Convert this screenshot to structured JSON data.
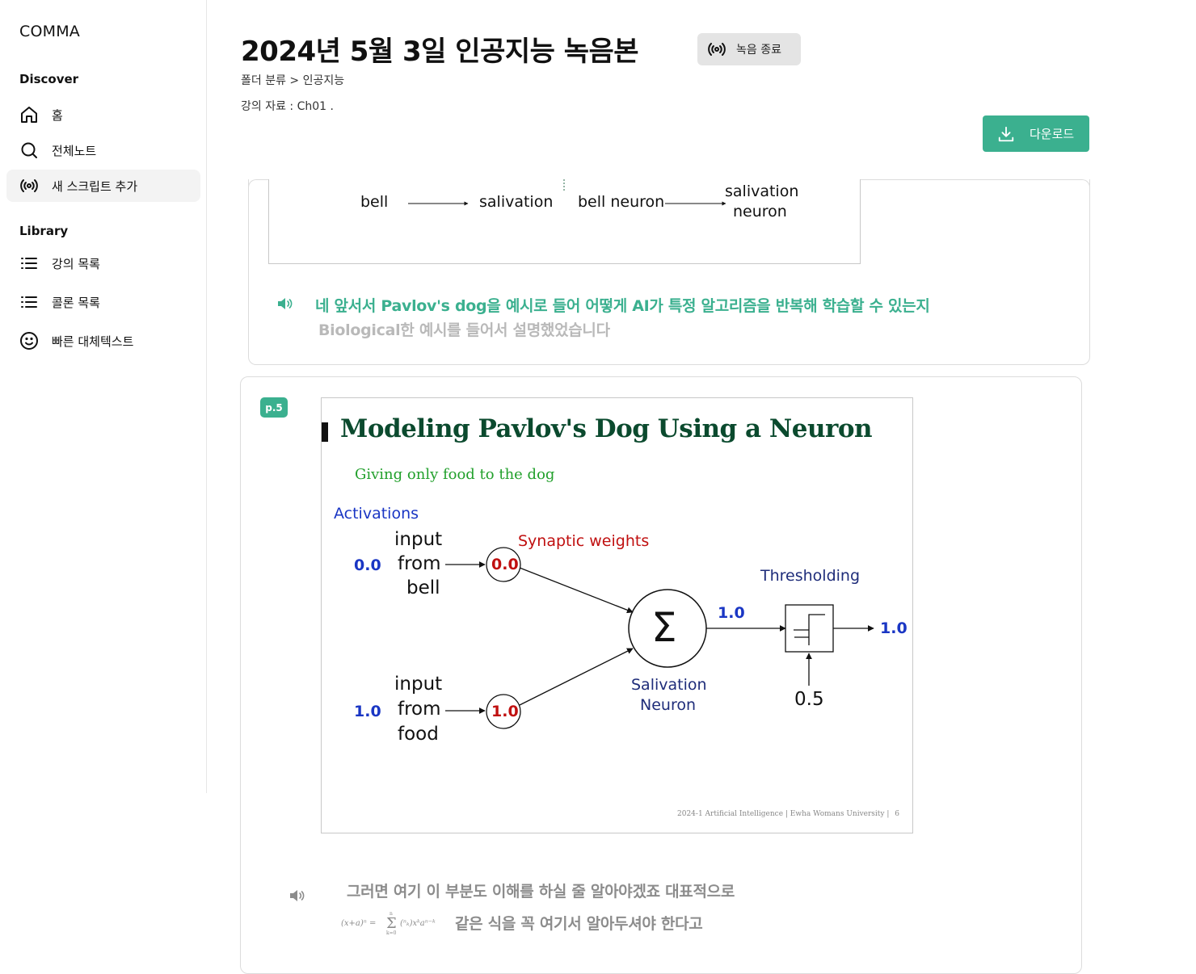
{
  "app": {
    "logo": "COMMA"
  },
  "sidebar": {
    "discover_title": "Discover",
    "discover_items": [
      {
        "label": "홈",
        "icon": "home-icon"
      },
      {
        "label": "전체노트",
        "icon": "search-icon"
      },
      {
        "label": "새 스크립트 추가",
        "icon": "broadcast-icon",
        "active": true
      }
    ],
    "library_title": "Library",
    "library_items": [
      {
        "label": "강의 목록",
        "icon": "list-icon"
      },
      {
        "label": "콜론 목록",
        "icon": "list-icon"
      },
      {
        "label": "빠른 대체텍스트",
        "icon": "smiley-icon"
      }
    ]
  },
  "header": {
    "title": "2024년 5월 3일 인공지능 녹음본",
    "record_label": "녹음 종료",
    "breadcrumb": "폴더 분류 > 인공지능",
    "material": "강의 자료 : Ch01 .",
    "download_label": "다운로드"
  },
  "card1": {
    "slide_snippet": {
      "bell": "bell",
      "salivation": "salivation",
      "bell_neuron": "bell neuron",
      "salivation_neuron_1": "salivation",
      "salivation_neuron_2": "neuron"
    },
    "transcript_active": "네 앞서서 Pavlov's dog을 예시로 들어 어떻게 AI가 특정 알고리즘을 반복해 학습할 수 있는지",
    "transcript_gray": "Biological한 예시를 들어서 설명했었습니다"
  },
  "card2": {
    "page_badge": "p.5",
    "slide": {
      "title": "Modeling Pavlov's Dog Using a Neuron",
      "subtitle": "Giving only food to the dog",
      "activations": "Activations",
      "synaptic_weights": "Synaptic weights",
      "thresholding": "Thresholding",
      "input1_activation": "0.0",
      "input1_lines": [
        "input",
        "from",
        "bell"
      ],
      "weight1": "0.0",
      "input2_activation": "1.0",
      "input2_lines": [
        "input",
        "from",
        "food"
      ],
      "weight2": "1.0",
      "sum_symbol": "Σ",
      "sum_output": "1.0",
      "neuron_label_1": "Salivation",
      "neuron_label_2": "Neuron",
      "threshold_value": "0.5",
      "final_output": "1.0",
      "footer": "2024-1 Artificial Intelligence  |  Ewha Womans University  |",
      "footer_page": "6"
    },
    "transcript_line1": "그러면 여기 이 부분도 이해를 하실 줄 알아야겠죠 대표적으로",
    "formula": "(x+a)ⁿ = Σ (n k) xᵏ aⁿ⁻ᵏ",
    "transcript_line2": "같은 식을 꼭 여기서 알아두셔야 한다고"
  },
  "colors": {
    "accent": "#3bb08f",
    "slide_title": "#0b4a2e",
    "slide_subtitle": "#22a02c",
    "blue": "#1a36c4",
    "red": "#c01010",
    "navy": "#1f2d7a"
  }
}
